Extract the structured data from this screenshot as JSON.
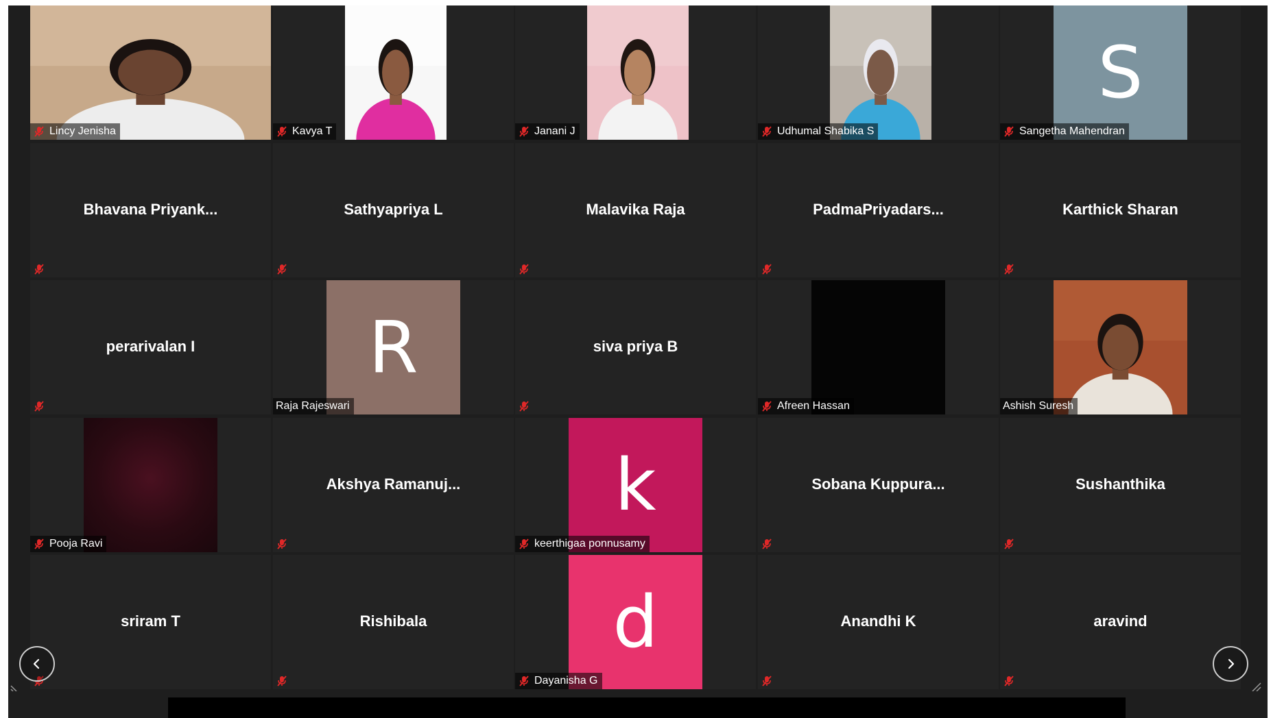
{
  "meeting": {
    "participants": [
      {
        "name": "Lincy Jenisha",
        "video": "photo",
        "muted": true
      },
      {
        "name": "Kavya T",
        "video": "photo",
        "muted": true
      },
      {
        "name": "Janani J",
        "video": "photo",
        "muted": true
      },
      {
        "name": "Udhumal Shabika S",
        "video": "photo",
        "muted": true
      },
      {
        "name": "Sangetha Mahendran",
        "video": "initial",
        "initial": "S",
        "avatar_color": "#7d949f",
        "muted": true
      },
      {
        "name": "Bhavana  Priyank...",
        "video": "off",
        "muted": true
      },
      {
        "name": "Sathyapriya L",
        "video": "off",
        "muted": true
      },
      {
        "name": "Malavika Raja",
        "video": "off",
        "muted": true
      },
      {
        "name": "PadmaPriyadars...",
        "video": "off",
        "muted": true
      },
      {
        "name": "Karthick Sharan",
        "video": "off",
        "muted": true
      },
      {
        "name": "perarivalan I",
        "video": "off",
        "muted": true
      },
      {
        "name": "Raja Rajeswari",
        "video": "initial",
        "initial": "R",
        "avatar_color": "#8c7067",
        "muted": false
      },
      {
        "name": "siva priya B",
        "video": "off",
        "muted": true
      },
      {
        "name": "Afreen Hassan",
        "video": "dark",
        "muted": true
      },
      {
        "name": "Ashish Suresh",
        "video": "photo",
        "muted": false
      },
      {
        "name": "Pooja Ravi",
        "video": "dark-red",
        "muted": true
      },
      {
        "name": "Akshya  Ramanuj...",
        "video": "off",
        "muted": true
      },
      {
        "name": "keerthigaa ponnusamy",
        "video": "initial",
        "initial": "k",
        "avatar_color": "#c2185b",
        "muted": true
      },
      {
        "name": "Sobana  Kuppura...",
        "video": "off",
        "muted": true
      },
      {
        "name": "Sushanthika",
        "video": "off",
        "muted": true
      },
      {
        "name": "sriram T",
        "video": "off",
        "muted": true
      },
      {
        "name": "Rishibala",
        "video": "off",
        "muted": true
      },
      {
        "name": "Dayanisha G",
        "video": "initial",
        "initial": "d",
        "avatar_color": "#e8336d",
        "muted": true
      },
      {
        "name": "Anandhi K",
        "video": "off",
        "muted": true
      },
      {
        "name": "aravind",
        "video": "off",
        "muted": true
      }
    ]
  },
  "icons": {
    "muted_mic": "muted-mic-icon",
    "prev": "chevron-left-icon",
    "next": "chevron-right-icon"
  },
  "colors": {
    "background": "#1e1e1e",
    "tile": "#232323",
    "muted_icon": "#e02828"
  }
}
